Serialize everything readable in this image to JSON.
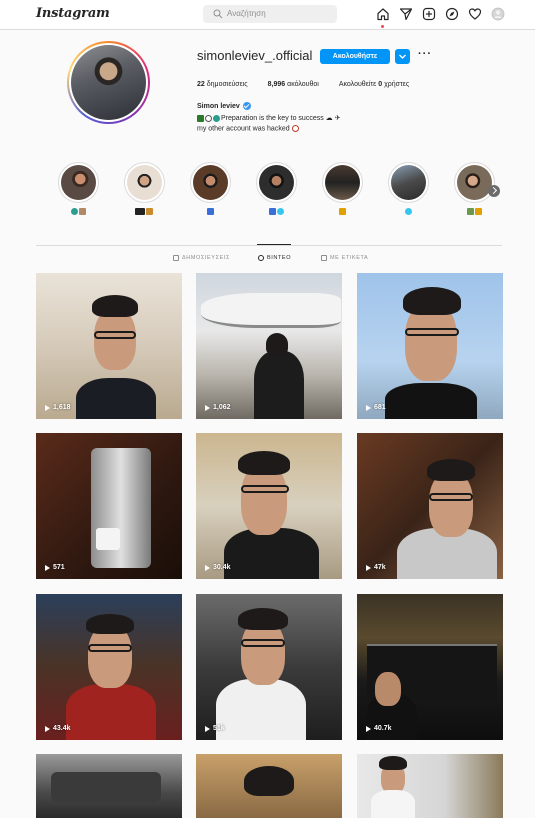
{
  "header": {
    "logo": "Instagram",
    "search_placeholder": "Αναζήτηση",
    "icons": [
      "home-icon",
      "direct-icon",
      "new-post-icon",
      "explore-icon",
      "activity-icon",
      "profile-avatar"
    ]
  },
  "profile": {
    "username": "simonleviev_.official",
    "follow_label": "Ακολουθήστε",
    "posts_count": "22",
    "posts_label": "δημοσιεύσεις",
    "followers_count": "8,996",
    "followers_label": "ακόλουθοι",
    "following_prefix": "Ακολουθείτε",
    "following_count": "0",
    "following_suffix": "χρήστες",
    "full_name": "Simon leviev",
    "bio_line1": "Preparation is the key to success",
    "bio_line2": "my other account was hacked"
  },
  "highlights": [
    {
      "emoji_colors": [
        "#2a9d8f",
        "#b08968"
      ]
    },
    {
      "emoji_colors": [
        "#222222",
        "#c98b2b"
      ]
    },
    {
      "emoji_colors": [
        "#3a6fd8"
      ]
    },
    {
      "emoji_colors": [
        "#3a6fd8",
        "#36c5f0"
      ]
    },
    {
      "emoji_colors": [
        "#e0a100"
      ]
    },
    {
      "emoji_colors": [
        "#36c5f0"
      ]
    },
    {
      "emoji_colors": [
        "#6a994e",
        "#e0a100"
      ]
    }
  ],
  "tabs": {
    "posts": "ΔΗΜΟΣΙΕΥΣΕΙΣ",
    "videos": "ΒΙΝΤΕΟ",
    "tagged": "ΜΕ ΕΤΙΚΕΤΑ"
  },
  "videos": [
    {
      "views": "1,618"
    },
    {
      "views": "1,062"
    },
    {
      "views": "681"
    },
    {
      "views": "571"
    },
    {
      "views": "30.4k"
    },
    {
      "views": "47k"
    },
    {
      "views": "43.4k"
    },
    {
      "views": "51k"
    },
    {
      "views": "40.7k"
    },
    {
      "views": ""
    },
    {
      "views": ""
    },
    {
      "views": ""
    }
  ],
  "colors": {
    "accent": "#0095f6",
    "border": "#dbdbdb",
    "background": "#fafafa"
  }
}
